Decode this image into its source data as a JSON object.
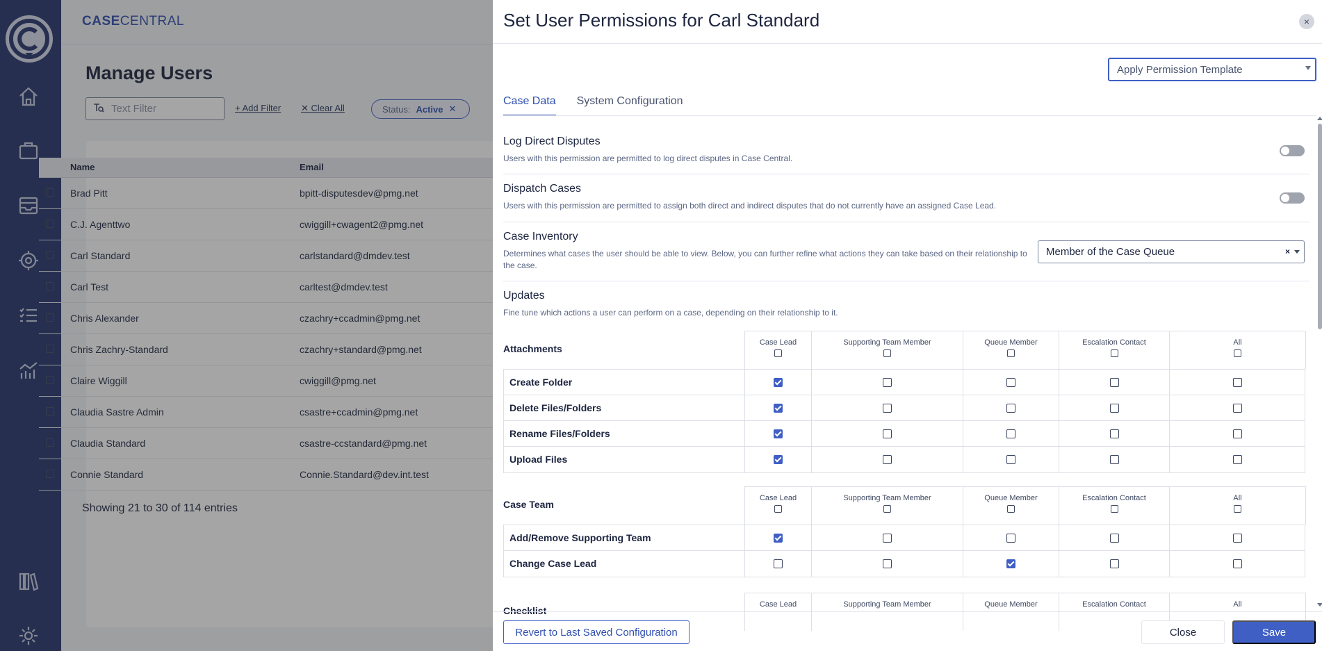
{
  "brand": {
    "bold": "CASE",
    "light": "CENTRAL"
  },
  "nav": {
    "icons": [
      "home-icon",
      "briefcase-icon",
      "inbox-icon",
      "target-icon",
      "checklist-icon",
      "chart-icon",
      "library-icon",
      "gear-icon"
    ]
  },
  "page": {
    "title": "Manage Users",
    "filter_placeholder": "Text Filter",
    "add_filter": "Add Filter",
    "clear_all": "Clear All",
    "status_label": "Status:",
    "status_value": "Active",
    "columns": {
      "name": "Name",
      "email": "Email"
    },
    "rows": [
      {
        "name": "Brad Pitt",
        "email": "bpitt-disputesdev@pmg.net"
      },
      {
        "name": "C.J. Agenttwo",
        "email": "cwiggill+cwagent2@pmg.net"
      },
      {
        "name": "Carl Standard",
        "email": "carlstandard@dmdev.test"
      },
      {
        "name": "Carl Test",
        "email": "carltest@dmdev.test"
      },
      {
        "name": "Chris Alexander",
        "email": "czachry+ccadmin@pmg.net"
      },
      {
        "name": "Chris Zachry-Standard",
        "email": "czachry+standard@pmg.net"
      },
      {
        "name": "Claire Wiggill",
        "email": "cwiggill@pmg.net"
      },
      {
        "name": "Claudia Sastre Admin",
        "email": "csastre+ccadmin@pmg.net"
      },
      {
        "name": "Claudia Standard",
        "email": "csastre-ccstandard@pmg.net"
      },
      {
        "name": "Connie Standard",
        "email": "Connie.Standard@dev.int.test"
      }
    ],
    "entries": "Showing 21 to 30 of 114 entries"
  },
  "drawer": {
    "title": "Set User Permissions for Carl Standard",
    "close_glyph": "×",
    "template_select": "Apply Permission Template",
    "tabs": [
      {
        "label": "Case Data",
        "active": true
      },
      {
        "label": "System Configuration",
        "active": false
      }
    ],
    "log_direct": {
      "title": "Log Direct Disputes",
      "desc": "Users with this permission are permitted to log direct disputes in Case Central.",
      "enabled": false
    },
    "dispatch": {
      "title": "Dispatch Cases",
      "desc": "Users with this permission are permitted to assign both direct and indirect disputes that do not currently have an assigned Case Lead.",
      "enabled": false
    },
    "inventory": {
      "title": "Case Inventory",
      "desc": "Determines what cases the user should be able to view. Below, you can further refine what actions they can take based on their relationship to the case.",
      "value": "Member of the Case Queue",
      "clear_glyph": "×"
    },
    "updates": {
      "title": "Updates",
      "desc": "Fine tune which actions a user can perform on a case, depending on their relationship to it."
    },
    "columns": [
      "Case Lead",
      "Supporting Team Member",
      "Queue Member",
      "Escalation Contact",
      "All"
    ],
    "grids": [
      {
        "section": "Attachments",
        "rows": [
          {
            "label": "Create Folder",
            "checks": [
              true,
              false,
              false,
              false,
              false
            ]
          },
          {
            "label": "Delete Files/Folders",
            "checks": [
              true,
              false,
              false,
              false,
              false
            ]
          },
          {
            "label": "Rename Files/Folders",
            "checks": [
              true,
              false,
              false,
              false,
              false
            ]
          },
          {
            "label": "Upload Files",
            "checks": [
              true,
              false,
              false,
              false,
              false
            ]
          }
        ]
      },
      {
        "section": "Case Team",
        "rows": [
          {
            "label": "Add/Remove Supporting Team",
            "checks": [
              true,
              false,
              false,
              false,
              false
            ]
          },
          {
            "label": "Change Case Lead",
            "checks": [
              false,
              false,
              true,
              false,
              false
            ]
          }
        ]
      },
      {
        "section": "Checklist",
        "rows": []
      }
    ],
    "footer": {
      "revert": "Revert to Last Saved Configuration",
      "close": "Close",
      "save": "Save"
    }
  },
  "colors": {
    "rail": "#26346f",
    "accent": "#3f5fc5"
  }
}
